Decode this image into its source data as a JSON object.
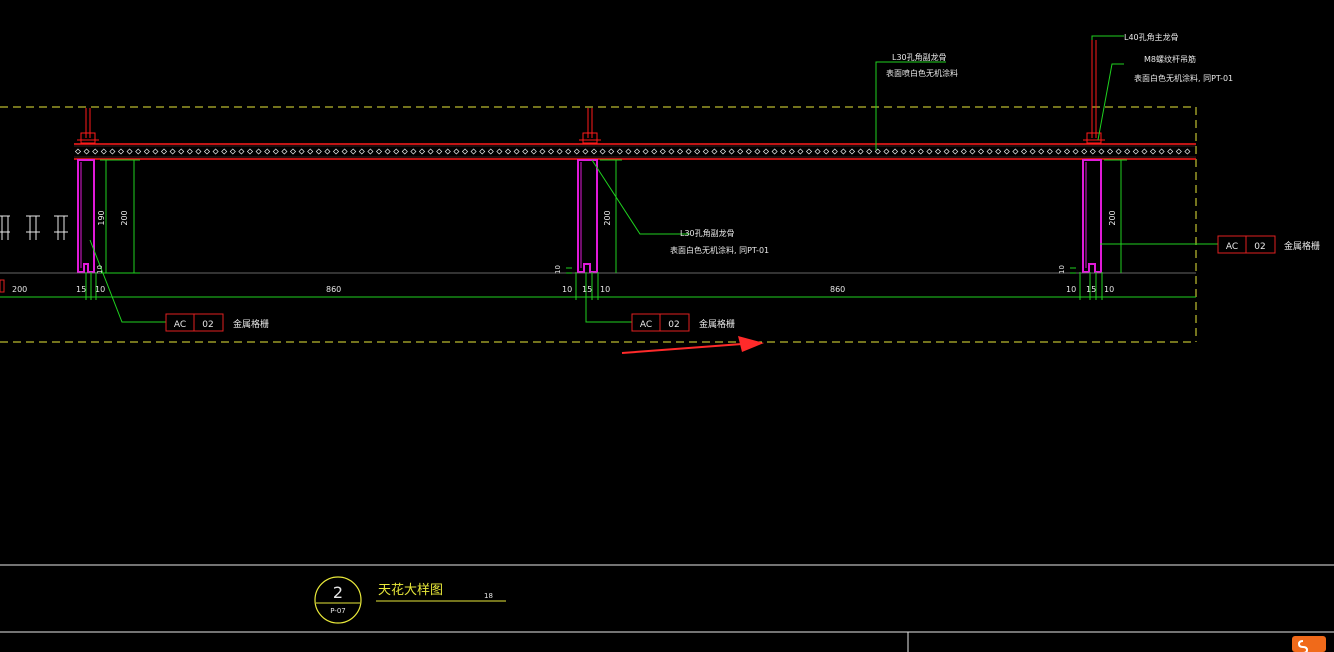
{
  "colors": {
    "background": "#000000",
    "red": "#ff1a1a",
    "magenta": "#e01ad9",
    "green": "#1fd11f",
    "yellow": "#e8e83a",
    "white": "#e8e8e8",
    "tag_red": "#e02020"
  },
  "labels": {
    "top_mid_line1": "L30孔角副龙骨",
    "top_mid_line2": "表面喷白色无机涂料",
    "top_right_a": "L40孔角主龙骨",
    "top_right_b_line1": "M8螺纹杆吊筋",
    "top_right_b_line2": "表面白色无机涂料, 同PT-01",
    "mid_line1": "L30孔角副龙骨",
    "mid_line2": "表面白色无机涂料, 同PT-01"
  },
  "tags": [
    {
      "code": "AC",
      "num": "02",
      "desc": "金属格栅"
    },
    {
      "code": "AC",
      "num": "02",
      "desc": "金属格栅"
    },
    {
      "code": "AC",
      "num": "02",
      "desc": "金属格栅"
    }
  ],
  "dims": {
    "h190": "190",
    "h200a": "200",
    "h200b": "200",
    "h200c": "200",
    "d200": "200",
    "d15a": "15",
    "d10a": "10",
    "d860a": "860",
    "d10b": "10",
    "d15b": "15",
    "d10c": "10",
    "d860b": "860",
    "d10d": "10",
    "d15c": "15",
    "d10e": "10",
    "s10a": "10",
    "s10b": "10",
    "s10c": "10"
  },
  "title_block": {
    "number": "2",
    "sheet": "P-07",
    "title": "天花大样图",
    "scale": "18"
  }
}
